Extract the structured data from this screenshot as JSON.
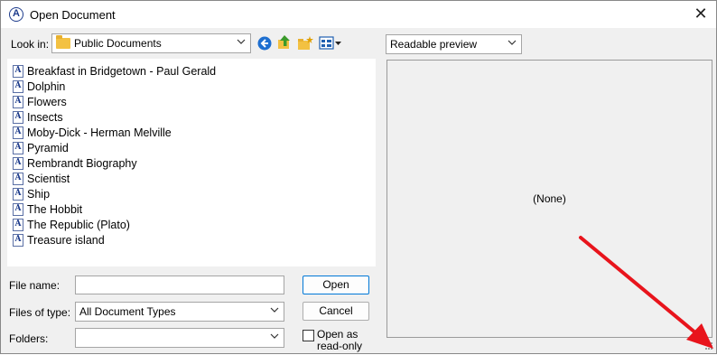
{
  "window": {
    "title": "Open Document",
    "close_glyph": "✕",
    "app_icon_glyph": "A"
  },
  "lookin": {
    "label": "Look in:",
    "value": "Public Documents"
  },
  "toolbar": {
    "icons": [
      "back-icon",
      "up-folder-icon",
      "new-folder-icon",
      "view-menu-icon"
    ]
  },
  "files": [
    "Breakfast in Bridgetown - Paul Gerald",
    "Dolphin",
    "Flowers",
    "Insects",
    "Moby-Dick - Herman Melville",
    "Pyramid",
    "Rembrandt Biography",
    "Scientist",
    "Ship",
    "The Hobbit",
    "The Republic (Plato)",
    "Treasure island"
  ],
  "file_icon_glyph": "A",
  "filename": {
    "label": "File name:",
    "value": ""
  },
  "filetype": {
    "label": "Files of type:",
    "value": "All Document Types"
  },
  "folders": {
    "label": "Folders:",
    "value": ""
  },
  "buttons": {
    "open": "Open",
    "cancel": "Cancel"
  },
  "readonly": {
    "label_line1": "Open as",
    "label_line2": "read-only",
    "checked": false
  },
  "preview": {
    "mode": "Readable preview",
    "content": "(None)"
  },
  "annotation": {
    "arrow_color": "#e8141c"
  },
  "colors": {
    "accent": "#0078d7",
    "folder": "#f3c142"
  }
}
